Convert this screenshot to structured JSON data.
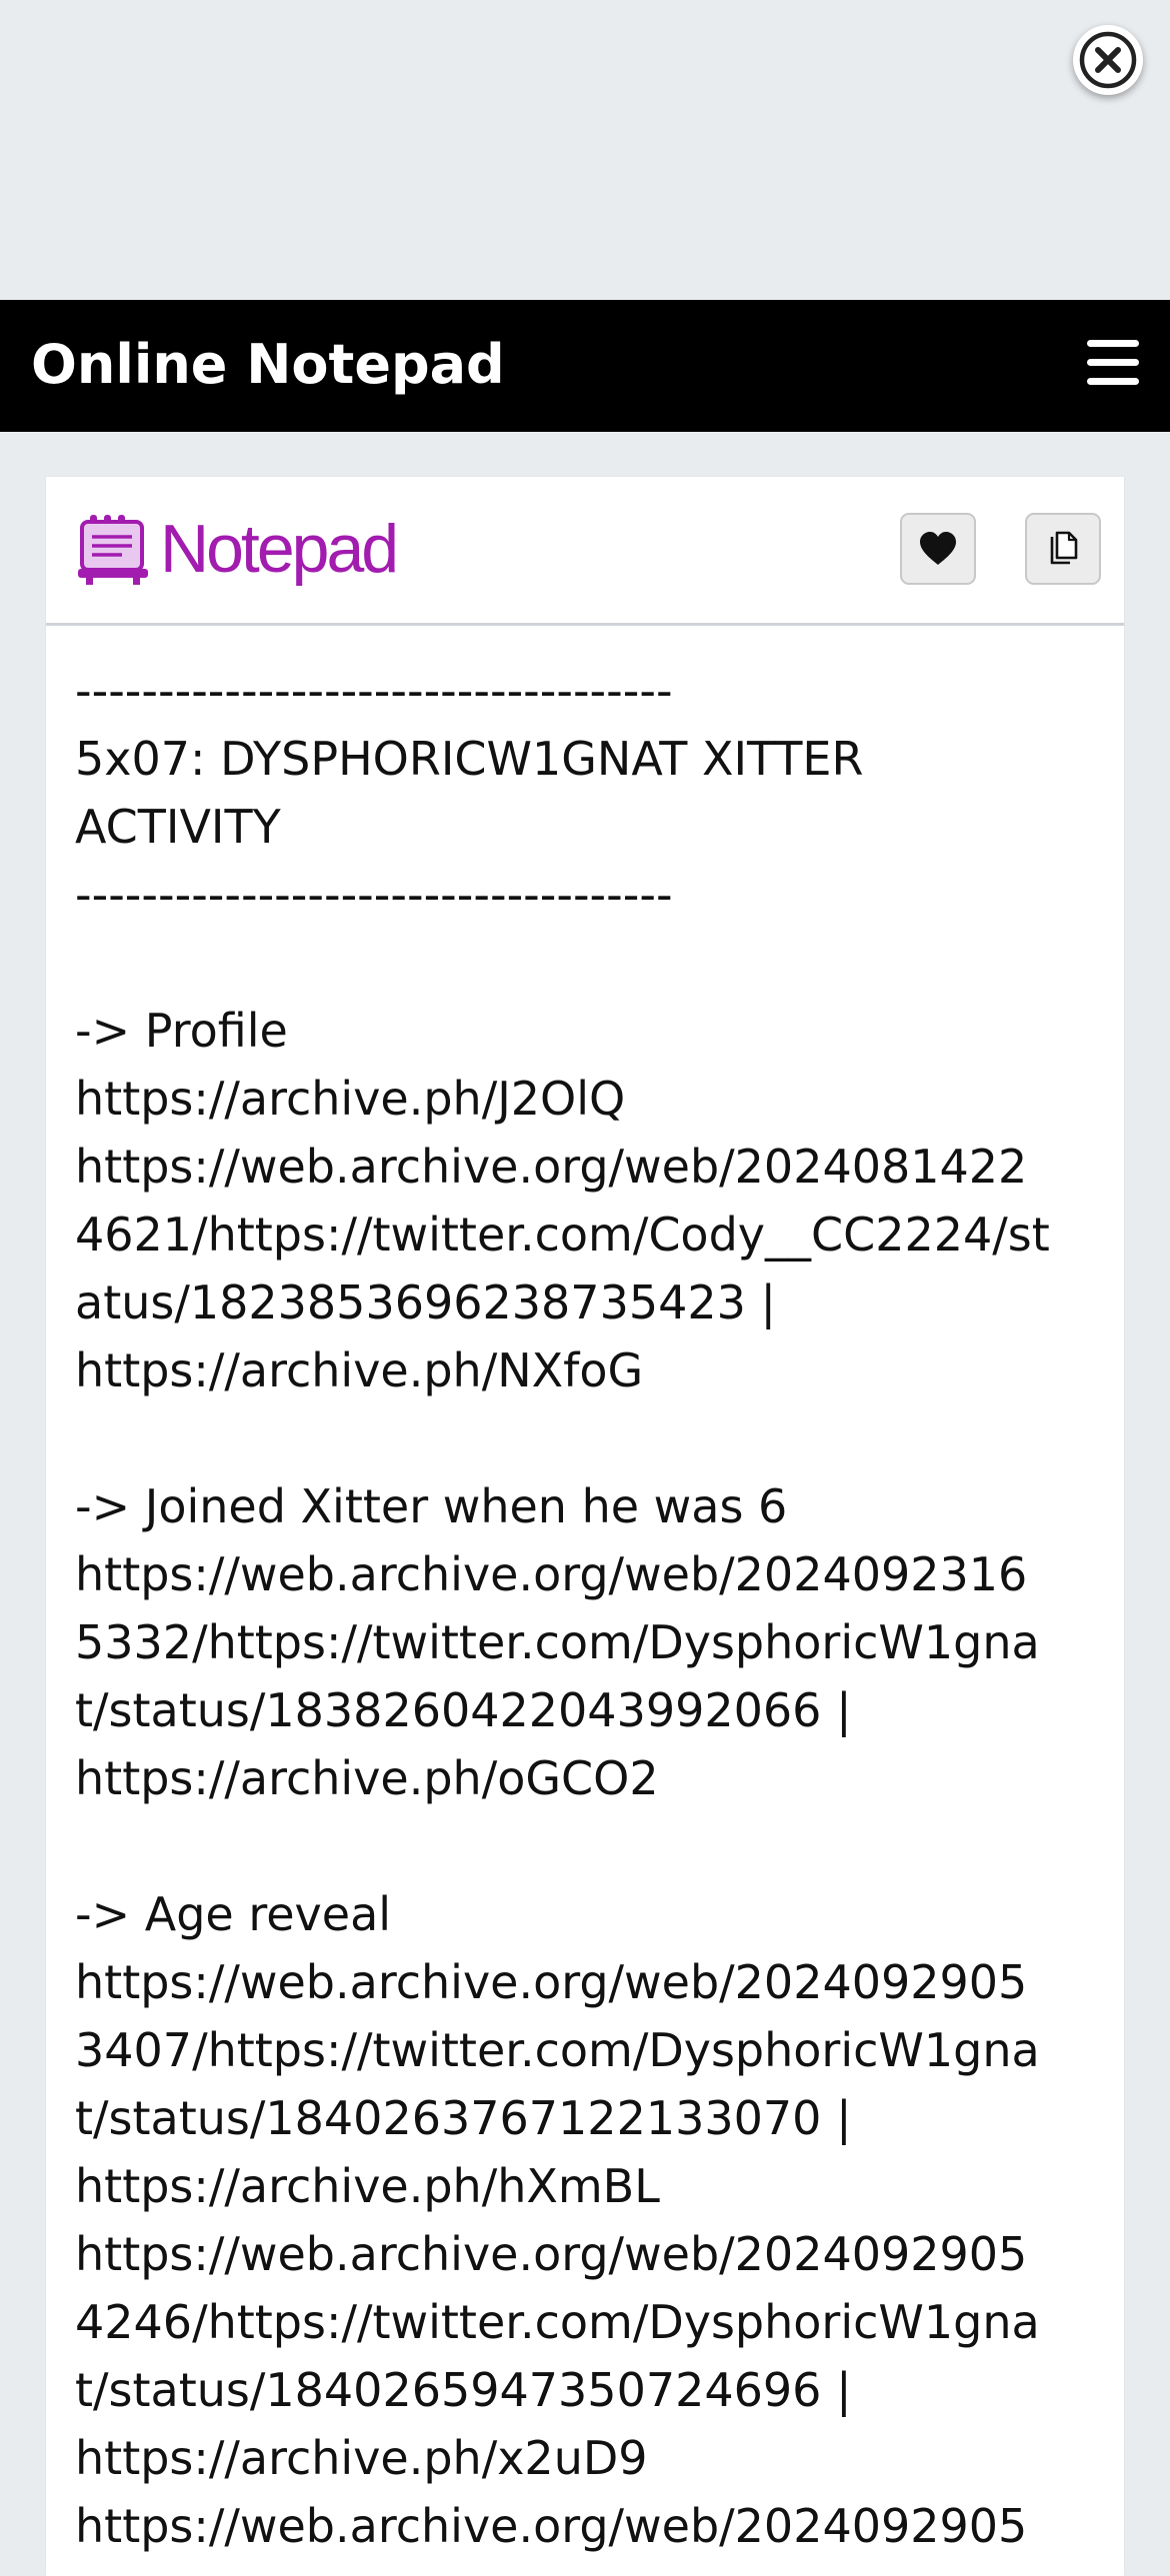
{
  "overlay": {
    "close_icon": "close-x-icon"
  },
  "navbar": {
    "title": "Online Notepad",
    "menu_icon": "hamburger-menu-icon"
  },
  "card": {
    "logo_text": "Notepad",
    "logo_icon": "notepad-logo-icon",
    "favorite_icon": "heart-icon",
    "copy_icon": "copy-icon",
    "accent_color": "#a21caf"
  },
  "note": {
    "lines": [
      "------------------------------------",
      "5x07: DYSPHORICW1GNAT XITTER",
      "ACTIVITY",
      "------------------------------------",
      "",
      "-> Profile",
      "https://archive.ph/J2OlQ",
      "https://web.archive.org/web/2024081422",
      "4621/https://twitter.com/Cody__CC2224/st",
      "atus/1823853696238735423 |",
      "https://archive.ph/NXfoG",
      "",
      "-> Joined Xitter when he was 6",
      "https://web.archive.org/web/2024092316",
      "5332/https://twitter.com/DysphoricW1gna",
      "t/status/1838260422043992066 |",
      "https://archive.ph/oGCO2",
      "",
      "-> Age reveal",
      "https://web.archive.org/web/2024092905",
      "3407/https://twitter.com/DysphoricW1gna",
      "t/status/1840263767122133070 |",
      "https://archive.ph/hXmBL",
      "https://web.archive.org/web/2024092905",
      "4246/https://twitter.com/DysphoricW1gna",
      "t/status/1840265947350724696 |",
      "https://archive.ph/x2uD9",
      "https://web.archive.org/web/2024092905"
    ]
  }
}
